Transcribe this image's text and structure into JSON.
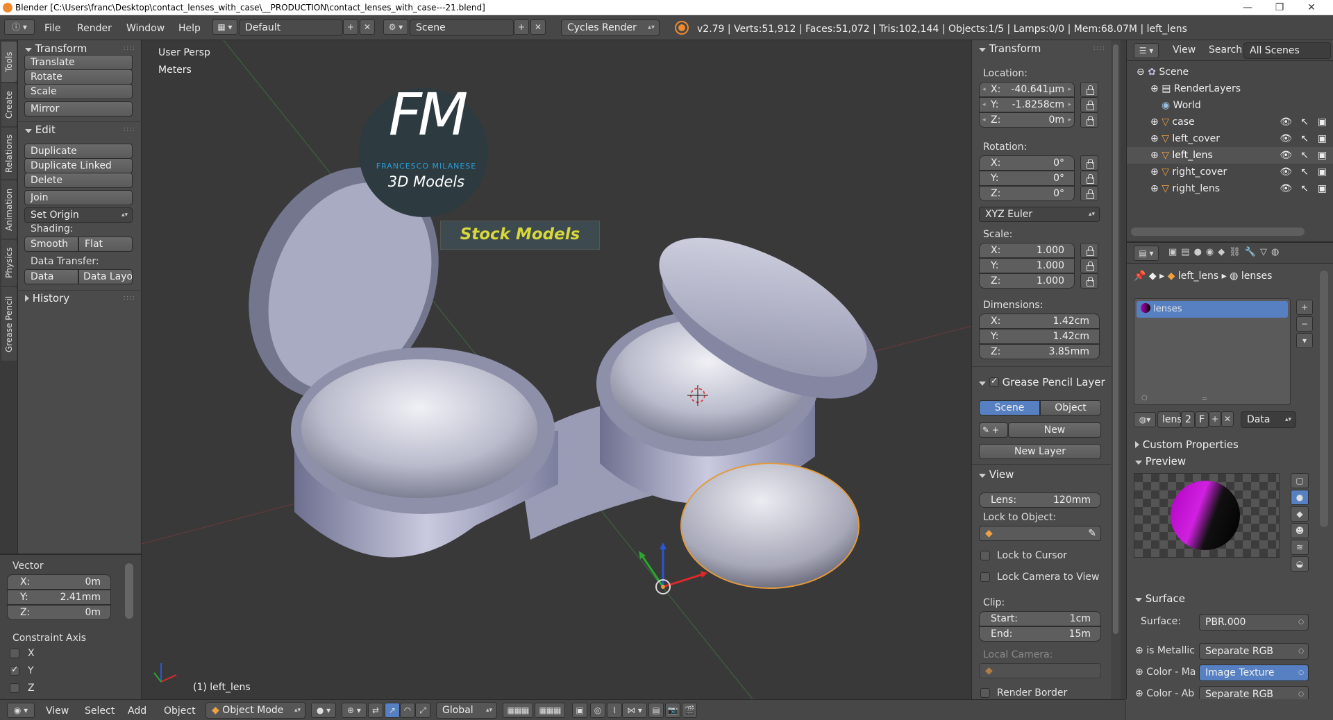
{
  "window": {
    "title": "Blender [C:\\Users\\franc\\Desktop\\contact_lenses_with_case\\__PRODUCTION\\contact_lenses_with_case---21.blend]"
  },
  "topbar": {
    "menus": [
      "File",
      "Render",
      "Window",
      "Help"
    ],
    "layout": "Default",
    "scene": "Scene",
    "engine": "Cycles Render",
    "stats": "v2.79 | Verts:51,912 | Faces:51,072 | Tris:102,144 | Objects:1/5 | Lamps:0/0 | Mem:68.07M | left_lens"
  },
  "tabs": [
    "Tools",
    "Create",
    "Relations",
    "Animation",
    "Physics",
    "Grease Pencil"
  ],
  "toolshelf": {
    "transform_header": "Transform",
    "transform_buttons": [
      "Translate",
      "Rotate",
      "Scale"
    ],
    "mirror": "Mirror",
    "edit_header": "Edit",
    "edit_buttons": [
      "Duplicate",
      "Duplicate Linked",
      "Delete"
    ],
    "join": "Join",
    "set_origin": "Set Origin",
    "shading_label": "Shading:",
    "smooth": "Smooth",
    "flat": "Flat",
    "data_transfer_label": "Data Transfer:",
    "data": "Data",
    "data_layout": "Data Layo",
    "history": "History"
  },
  "operator": {
    "vector_label": "Vector",
    "x_label": "X:",
    "x_value": "0m",
    "y_label": "Y:",
    "y_value": "2.41mm",
    "z_label": "Z:",
    "z_value": "0m",
    "constraint_label": "Constraint Axis",
    "axes": [
      "X",
      "Y",
      "Z"
    ],
    "checked": [
      false,
      true,
      false
    ]
  },
  "viewport": {
    "view_name": "User Persp",
    "units": "Meters",
    "selected": "(1) left_lens",
    "logo_initials": "FM",
    "logo_name": "FRANCESCO MILANESE",
    "logo_sub": "3D Models",
    "banner": "Stock Models"
  },
  "npanel": {
    "transform_header": "Transform",
    "location_label": "Location:",
    "loc": [
      "-40.641µm",
      "-1.8258cm",
      "0m"
    ],
    "rotation_label": "Rotation:",
    "rot": [
      "0°",
      "0°",
      "0°"
    ],
    "rotation_mode": "XYZ Euler",
    "scale_label": "Scale:",
    "scale": [
      "1.000",
      "1.000",
      "1.000"
    ],
    "dimensions_label": "Dimensions:",
    "dims": [
      "1.42cm",
      "1.42cm",
      "3.85mm"
    ],
    "axis_labels": [
      "X:",
      "Y:",
      "Z:"
    ],
    "grease_header": "Grease Pencil Layer",
    "scene_btn": "Scene",
    "object_btn": "Object",
    "new_btn": "New",
    "new_layer_btn": "New Layer",
    "view_header": "View",
    "lens_label": "Lens:",
    "lens_value": "120mm",
    "lock_object_label": "Lock to Object:",
    "lock_cursor": "Lock to Cursor",
    "lock_camera": "Lock Camera to View",
    "clip_label": "Clip:",
    "start_label": "Start:",
    "start_value": "1cm",
    "end_label": "End:",
    "end_value": "15m",
    "local_camera": "Local Camera:",
    "render_border": "Render Border"
  },
  "outliner": {
    "menus": [
      "View",
      "Search"
    ],
    "filter": "All Scenes",
    "items": [
      "Scene",
      "RenderLayers",
      "World",
      "case",
      "left_cover",
      "left_lens",
      "right_cover",
      "right_lens"
    ]
  },
  "properties": {
    "breadcrumb_object": "left_lens",
    "breadcrumb_material": "lenses",
    "material_slot": "lenses",
    "mat_name": "lens",
    "mat_users": "2",
    "mat_fake": "F",
    "mat_link": "Data",
    "custom_props": "Custom Properties",
    "preview": "Preview",
    "surface_header": "Surface",
    "surface_label": "Surface:",
    "surface_value": "PBR.000",
    "inputs": [
      {
        "label": "is Metallic",
        "value": "Separate RGB"
      },
      {
        "label": "Color - Ma",
        "value": "Image Texture"
      },
      {
        "label": "Color - Ab",
        "value": "Separate RGB"
      }
    ]
  },
  "bottombar": {
    "menus": [
      "View",
      "Select",
      "Add",
      "Object"
    ],
    "mode": "Object Mode",
    "orientation": "Global"
  },
  "colors": {
    "accent": "#5680c2",
    "orange": "#f0892c",
    "banner_text": "#d8d83a",
    "logo_blue": "#2a9fd6"
  }
}
